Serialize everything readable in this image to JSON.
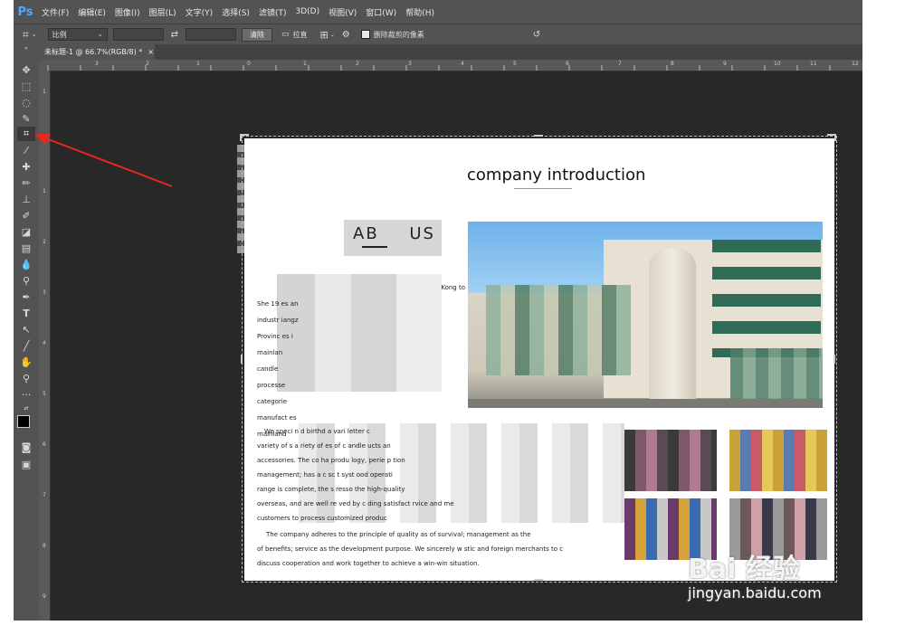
{
  "app": {
    "logo": "Ps"
  },
  "menu": [
    "文件(F)",
    "编辑(E)",
    "图像(I)",
    "图层(L)",
    "文字(Y)",
    "选择(S)",
    "滤镜(T)",
    "3D(D)",
    "视图(V)",
    "窗口(W)",
    "帮助(H)"
  ],
  "options": {
    "ratio_label": "比例",
    "clear_button": "清除",
    "straighten_label": "拉直",
    "delete_pixels_label": "删除裁剪的像素",
    "delete_pixels_checked": true
  },
  "tab": {
    "title": "未标题-1 @ 66.7%(RGB/8) *",
    "close": "×"
  },
  "ruler_top": [
    "3",
    "2",
    "1",
    "0",
    "1",
    "2",
    "3",
    "4",
    "5",
    "6",
    "7",
    "8",
    "9",
    "10",
    "11",
    "12"
  ],
  "ruler_left": [
    "1",
    "0",
    "1",
    "2",
    "3",
    "4",
    "5",
    "6",
    "7",
    "8",
    "9"
  ],
  "document": {
    "title": "company introduction",
    "about_heading": "AB US",
    "para1_lines": [
      "Kong to",
      "She 19 es an",
      "industr iangz",
      "Provinc es i",
      "mainlan",
      "candle",
      "processe",
      "categorie",
      "manufact es",
      "mainland"
    ],
    "para2_lines": [
      "We speci n d birthd a vari letter c",
      "variety of s a riety of es of c andle ucts an",
      "accessories. The co ha produ logy, perie p tion",
      "management; has a c sc t syst ood operati",
      "range is complete, the s resso the high-quality",
      "overseas, and are well re ved by c ding satisfact rvice and me",
      "customers to process customized produc"
    ],
    "para3_lines": [
      "The company adheres to the principle of quality as of survival; management as the",
      "of benefits; service as the development purpose. We sincerely w stic and foreign merchants to c",
      "discuss cooperation and work together to achieve a win-win situation."
    ]
  },
  "watermark": {
    "brand": "Bai 经验",
    "url": "jingyan.baidu.com"
  },
  "colors": {
    "ps_blue": "#4aa8ff",
    "arrow": "#e8271f",
    "workspace": "#282828",
    "panel": "#535353"
  }
}
